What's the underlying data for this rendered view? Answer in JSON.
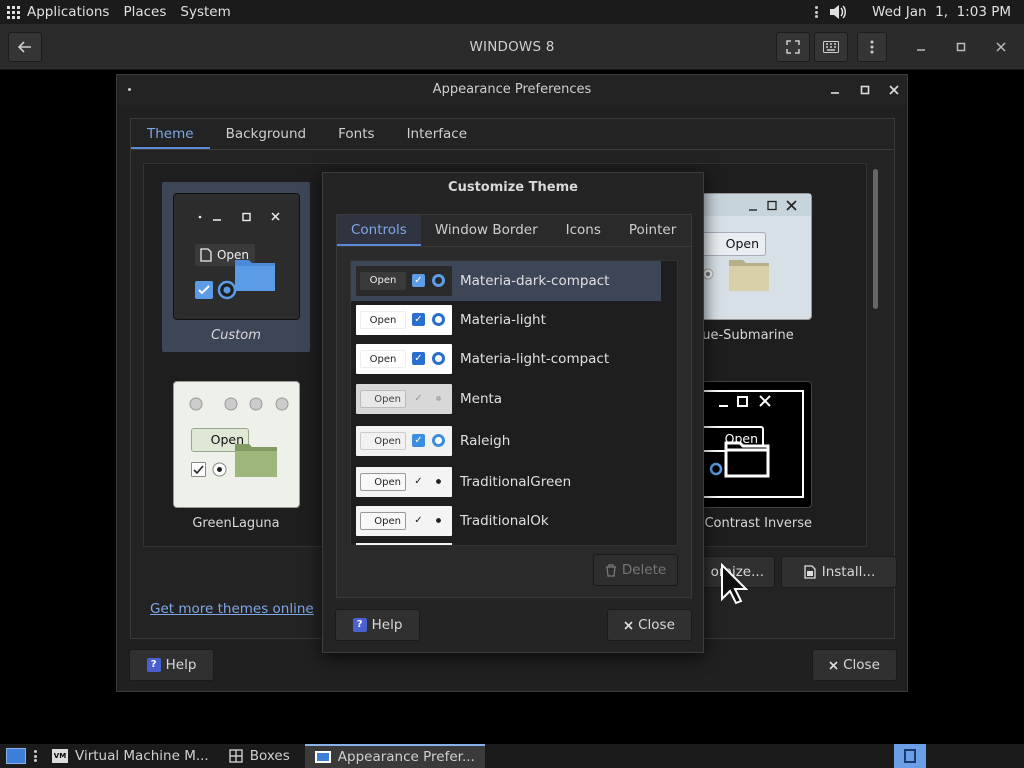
{
  "top_panel": {
    "applications": "Applications",
    "places": "Places",
    "system": "System",
    "clock": "Wed Jan  1,  1:03 PM"
  },
  "boxes": {
    "title": "WINDOWS 8"
  },
  "appearance": {
    "title": "Appearance Preferences",
    "tabs": [
      "Theme",
      "Background",
      "Fonts",
      "Interface"
    ],
    "themes": [
      {
        "name": "Custom"
      },
      {
        "name": "ue-Submarine"
      },
      {
        "name": "GreenLaguna"
      },
      {
        "name": "Contrast Inverse"
      }
    ],
    "get_more": "Get more themes online",
    "customize_label": "omize...",
    "install_label": "Install...",
    "help_label": "Help",
    "close_label": "Close"
  },
  "customize": {
    "title": "Customize Theme",
    "tabs": [
      "Controls",
      "Window Border",
      "Icons",
      "Pointer"
    ],
    "preview_open": "Open",
    "rows": [
      {
        "name": "Materia-dark-compact"
      },
      {
        "name": "Materia-light"
      },
      {
        "name": "Materia-light-compact"
      },
      {
        "name": "Menta"
      },
      {
        "name": "Raleigh"
      },
      {
        "name": "TraditionalGreen"
      },
      {
        "name": "TraditionalOk"
      }
    ],
    "delete_label": "Delete",
    "help_label": "Help",
    "close_label": "Close"
  },
  "taskbar": {
    "items": [
      "Virtual Machine M...",
      "Boxes",
      "Appearance Prefer..."
    ]
  }
}
